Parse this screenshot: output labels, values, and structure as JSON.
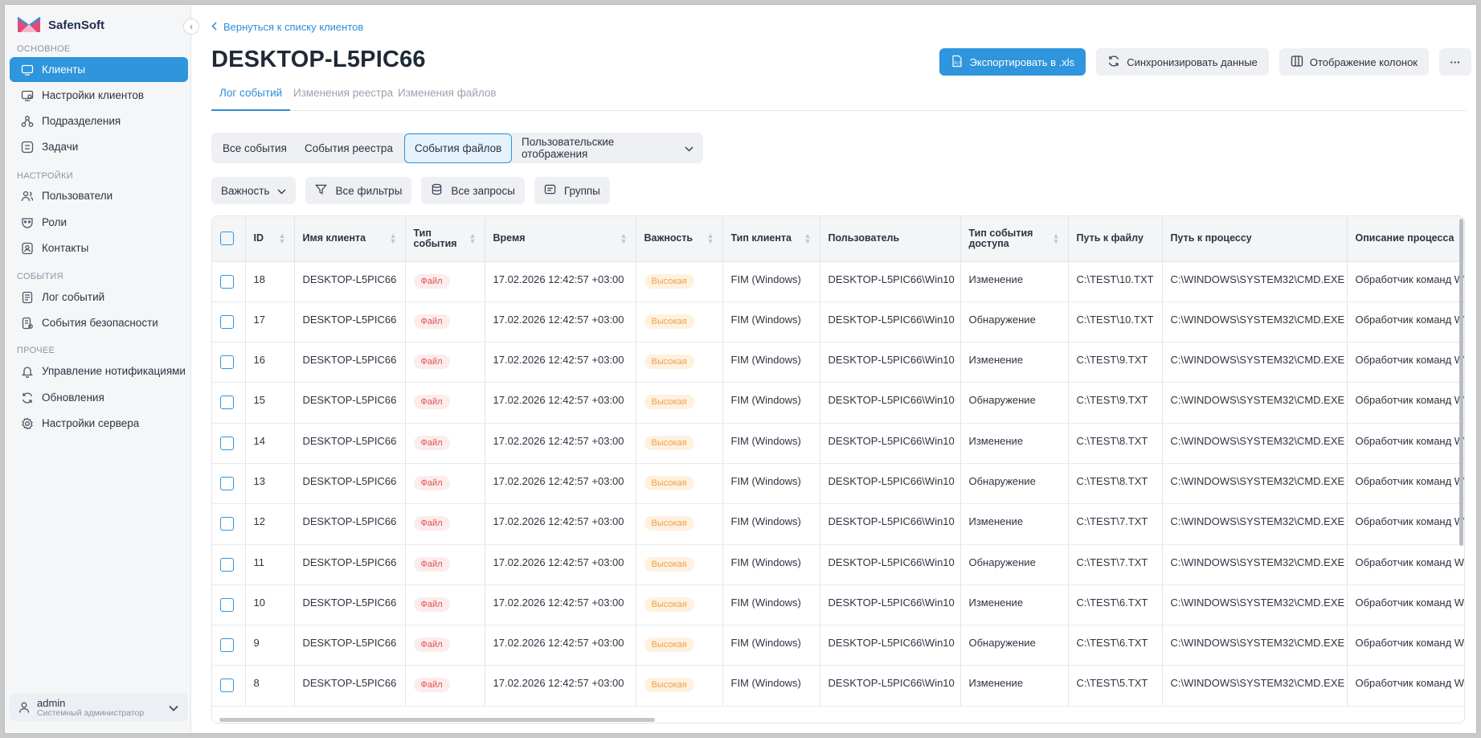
{
  "app": {
    "name": "SafenSoft"
  },
  "sidebar": {
    "sections": [
      {
        "title": "ОСНОВНОЕ",
        "items": [
          {
            "label": "Клиенты",
            "icon": "monitor-icon",
            "active": true
          },
          {
            "label": "Настройки клиентов",
            "icon": "monitor-settings-icon"
          },
          {
            "label": "Подразделения",
            "icon": "hierarchy-icon"
          },
          {
            "label": "Задачи",
            "icon": "tasks-icon"
          }
        ]
      },
      {
        "title": "НАСТРОЙКИ",
        "items": [
          {
            "label": "Пользователи",
            "icon": "users-icon"
          },
          {
            "label": "Роли",
            "icon": "mask-icon"
          },
          {
            "label": "Контакты",
            "icon": "contacts-icon"
          }
        ]
      },
      {
        "title": "СОБЫТИЯ",
        "items": [
          {
            "label": "Лог событий",
            "icon": "log-icon"
          },
          {
            "label": "События безопасности",
            "icon": "security-log-icon"
          }
        ]
      },
      {
        "title": "ПРОЧЕЕ",
        "items": [
          {
            "label": "Управление нотификациями",
            "icon": "bell-icon"
          },
          {
            "label": "Обновления",
            "icon": "refresh-icon"
          },
          {
            "label": "Настройки сервера",
            "icon": "gear-icon"
          }
        ]
      }
    ],
    "user": {
      "name": "admin",
      "role": "Системный администратор"
    }
  },
  "header": {
    "back_link": "Вернуться к списку клиентов",
    "title": "DESKTOP-L5PIC66",
    "actions": {
      "export": "Экспортировать в .xls",
      "sync": "Синхронизировать данные",
      "columns": "Отображение колонок",
      "more": "···"
    }
  },
  "tabs": [
    "Лог событий",
    "Изменения реестра",
    "Изменения файлов"
  ],
  "segments": [
    "Все события",
    "События реестра",
    "События файлов",
    "Пользовательские отображения"
  ],
  "filters": {
    "importance": "Важность",
    "all_filters": "Все фильтры",
    "all_queries": "Все запросы",
    "groups": "Группы"
  },
  "table": {
    "columns": [
      "ID",
      "Имя клиента",
      "Тип события",
      "Время",
      "Важность",
      "Тип клиента",
      "Пользователь",
      "Тип события доступа",
      "Путь к файлу",
      "Путь к процессу",
      "Описание процесса"
    ],
    "rows": [
      {
        "id": "18",
        "client": "DESKTOP-L5PIC66",
        "type": "Файл",
        "time": "17.02.2026 12:42:57 +03:00",
        "importance": "Высокая",
        "client_type": "FIM (Windows)",
        "user": "DESKTOP-L5PIC66\\Win10",
        "access": "Изменение",
        "file": "C:\\TEST\\10.TXT",
        "process": "C:\\WINDOWS\\SYSTEM32\\CMD.EXE",
        "desc": "Обработчик команд W"
      },
      {
        "id": "17",
        "client": "DESKTOP-L5PIC66",
        "type": "Файл",
        "time": "17.02.2026 12:42:57 +03:00",
        "importance": "Высокая",
        "client_type": "FIM (Windows)",
        "user": "DESKTOP-L5PIC66\\Win10",
        "access": "Обнаружение",
        "file": "C:\\TEST\\10.TXT",
        "process": "C:\\WINDOWS\\SYSTEM32\\CMD.EXE",
        "desc": "Обработчик команд W"
      },
      {
        "id": "16",
        "client": "DESKTOP-L5PIC66",
        "type": "Файл",
        "time": "17.02.2026 12:42:57 +03:00",
        "importance": "Высокая",
        "client_type": "FIM (Windows)",
        "user": "DESKTOP-L5PIC66\\Win10",
        "access": "Изменение",
        "file": "C:\\TEST\\9.TXT",
        "process": "C:\\WINDOWS\\SYSTEM32\\CMD.EXE",
        "desc": "Обработчик команд W"
      },
      {
        "id": "15",
        "client": "DESKTOP-L5PIC66",
        "type": "Файл",
        "time": "17.02.2026 12:42:57 +03:00",
        "importance": "Высокая",
        "client_type": "FIM (Windows)",
        "user": "DESKTOP-L5PIC66\\Win10",
        "access": "Обнаружение",
        "file": "C:\\TEST\\9.TXT",
        "process": "C:\\WINDOWS\\SYSTEM32\\CMD.EXE",
        "desc": "Обработчик команд W"
      },
      {
        "id": "14",
        "client": "DESKTOP-L5PIC66",
        "type": "Файл",
        "time": "17.02.2026 12:42:57 +03:00",
        "importance": "Высокая",
        "client_type": "FIM (Windows)",
        "user": "DESKTOP-L5PIC66\\Win10",
        "access": "Изменение",
        "file": "C:\\TEST\\8.TXT",
        "process": "C:\\WINDOWS\\SYSTEM32\\CMD.EXE",
        "desc": "Обработчик команд W"
      },
      {
        "id": "13",
        "client": "DESKTOP-L5PIC66",
        "type": "Файл",
        "time": "17.02.2026 12:42:57 +03:00",
        "importance": "Высокая",
        "client_type": "FIM (Windows)",
        "user": "DESKTOP-L5PIC66\\Win10",
        "access": "Обнаружение",
        "file": "C:\\TEST\\8.TXT",
        "process": "C:\\WINDOWS\\SYSTEM32\\CMD.EXE",
        "desc": "Обработчик команд W"
      },
      {
        "id": "12",
        "client": "DESKTOP-L5PIC66",
        "type": "Файл",
        "time": "17.02.2026 12:42:57 +03:00",
        "importance": "Высокая",
        "client_type": "FIM (Windows)",
        "user": "DESKTOP-L5PIC66\\Win10",
        "access": "Изменение",
        "file": "C:\\TEST\\7.TXT",
        "process": "C:\\WINDOWS\\SYSTEM32\\CMD.EXE",
        "desc": "Обработчик команд W"
      },
      {
        "id": "11",
        "client": "DESKTOP-L5PIC66",
        "type": "Файл",
        "time": "17.02.2026 12:42:57 +03:00",
        "importance": "Высокая",
        "client_type": "FIM (Windows)",
        "user": "DESKTOP-L5PIC66\\Win10",
        "access": "Обнаружение",
        "file": "C:\\TEST\\7.TXT",
        "process": "C:\\WINDOWS\\SYSTEM32\\CMD.EXE",
        "desc": "Обработчик команд W"
      },
      {
        "id": "10",
        "client": "DESKTOP-L5PIC66",
        "type": "Файл",
        "time": "17.02.2026 12:42:57 +03:00",
        "importance": "Высокая",
        "client_type": "FIM (Windows)",
        "user": "DESKTOP-L5PIC66\\Win10",
        "access": "Изменение",
        "file": "C:\\TEST\\6.TXT",
        "process": "C:\\WINDOWS\\SYSTEM32\\CMD.EXE",
        "desc": "Обработчик команд W"
      },
      {
        "id": "9",
        "client": "DESKTOP-L5PIC66",
        "type": "Файл",
        "time": "17.02.2026 12:42:57 +03:00",
        "importance": "Высокая",
        "client_type": "FIM (Windows)",
        "user": "DESKTOP-L5PIC66\\Win10",
        "access": "Обнаружение",
        "file": "C:\\TEST\\6.TXT",
        "process": "C:\\WINDOWS\\SYSTEM32\\CMD.EXE",
        "desc": "Обработчик команд W"
      },
      {
        "id": "8",
        "client": "DESKTOP-L5PIC66",
        "type": "Файл",
        "time": "17.02.2026 12:42:57 +03:00",
        "importance": "Высокая",
        "client_type": "FIM (Windows)",
        "user": "DESKTOP-L5PIC66\\Win10",
        "access": "Изменение",
        "file": "C:\\TEST\\5.TXT",
        "process": "C:\\WINDOWS\\SYSTEM32\\CMD.EXE",
        "desc": "Обработчик команд W"
      }
    ]
  }
}
